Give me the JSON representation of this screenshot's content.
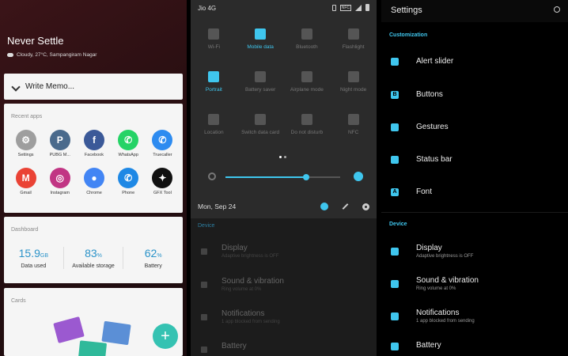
{
  "panel1": {
    "brand": "Never Settle",
    "weather": "Cloudy, 27°C, Sampangiram Nagar",
    "memo": "Write Memo...",
    "recent_title": "Recent apps",
    "apps": [
      {
        "label": "Settings",
        "color": "#9e9e9e",
        "glyph": "⚙"
      },
      {
        "label": "PUBG M...",
        "color": "#4a6a8c",
        "glyph": "P"
      },
      {
        "label": "Facebook",
        "color": "#3b5998",
        "glyph": "f"
      },
      {
        "label": "WhatsApp",
        "color": "#25d366",
        "glyph": "✆"
      },
      {
        "label": "Truecaller",
        "color": "#2d8bf0",
        "glyph": "✆"
      },
      {
        "label": "Gmail",
        "color": "#ea4335",
        "glyph": "M"
      },
      {
        "label": "Instagram",
        "color": "#c13584",
        "glyph": "◎"
      },
      {
        "label": "Chrome",
        "color": "#4285f4",
        "glyph": "●"
      },
      {
        "label": "Phone",
        "color": "#1e88e5",
        "glyph": "✆"
      },
      {
        "label": "GFX Tool",
        "color": "#111111",
        "glyph": "✦"
      }
    ],
    "dash_title": "Dashboard",
    "dash": [
      {
        "value": "15.9",
        "unit": "GB",
        "label": "Data used"
      },
      {
        "value": "83",
        "unit": "%",
        "label": "Available storage"
      },
      {
        "value": "62",
        "unit": "%",
        "label": "Battery"
      }
    ],
    "cards_title": "Cards",
    "fab": "+"
  },
  "panel2": {
    "carrier": "Jio 4G",
    "nfc_badge": "NFC",
    "tiles": [
      {
        "label": "Wi-Fi",
        "on": false
      },
      {
        "label": "Mobile data",
        "on": true
      },
      {
        "label": "Bluetooth",
        "on": false
      },
      {
        "label": "Flashlight",
        "on": false
      },
      {
        "label": "Portrait",
        "on": true
      },
      {
        "label": "Battery saver",
        "on": false
      },
      {
        "label": "Airplane mode",
        "on": false
      },
      {
        "label": "Night mode",
        "on": false
      },
      {
        "label": "Location",
        "on": false
      },
      {
        "label": "Switch data card",
        "on": false
      },
      {
        "label": "Do not disturb",
        "on": false
      },
      {
        "label": "NFC",
        "on": false
      }
    ],
    "brightness": 0.7,
    "date": "Mon, Sep 24",
    "section": "Device",
    "items": [
      {
        "title": "Display",
        "sub": "Adaptive brightness is OFF"
      },
      {
        "title": "Sound & vibration",
        "sub": "Ring volume at 0%"
      },
      {
        "title": "Notifications",
        "sub": "1 app blocked from sending"
      },
      {
        "title": "Battery",
        "sub": ""
      }
    ]
  },
  "panel3": {
    "title": "Settings",
    "section1": "Customization",
    "custom": [
      {
        "title": "Alert slider",
        "icon": "bell-icon",
        "glyph": ""
      },
      {
        "title": "Buttons",
        "icon": "buttons-icon",
        "glyph": "B"
      },
      {
        "title": "Gestures",
        "icon": "gesture-icon",
        "glyph": ""
      },
      {
        "title": "Status bar",
        "icon": "status-bar-icon",
        "glyph": ""
      },
      {
        "title": "Font",
        "icon": "font-icon",
        "glyph": "A"
      }
    ],
    "section2": "Device",
    "device": [
      {
        "title": "Display",
        "sub": "Adaptive brightness is OFF",
        "icon": "brightness-icon"
      },
      {
        "title": "Sound & vibration",
        "sub": "Ring volume at 0%",
        "icon": "speaker-icon"
      },
      {
        "title": "Notifications",
        "sub": "1 app blocked from sending",
        "icon": "bell-icon"
      },
      {
        "title": "Battery",
        "sub": "",
        "icon": "battery-icon"
      }
    ]
  }
}
